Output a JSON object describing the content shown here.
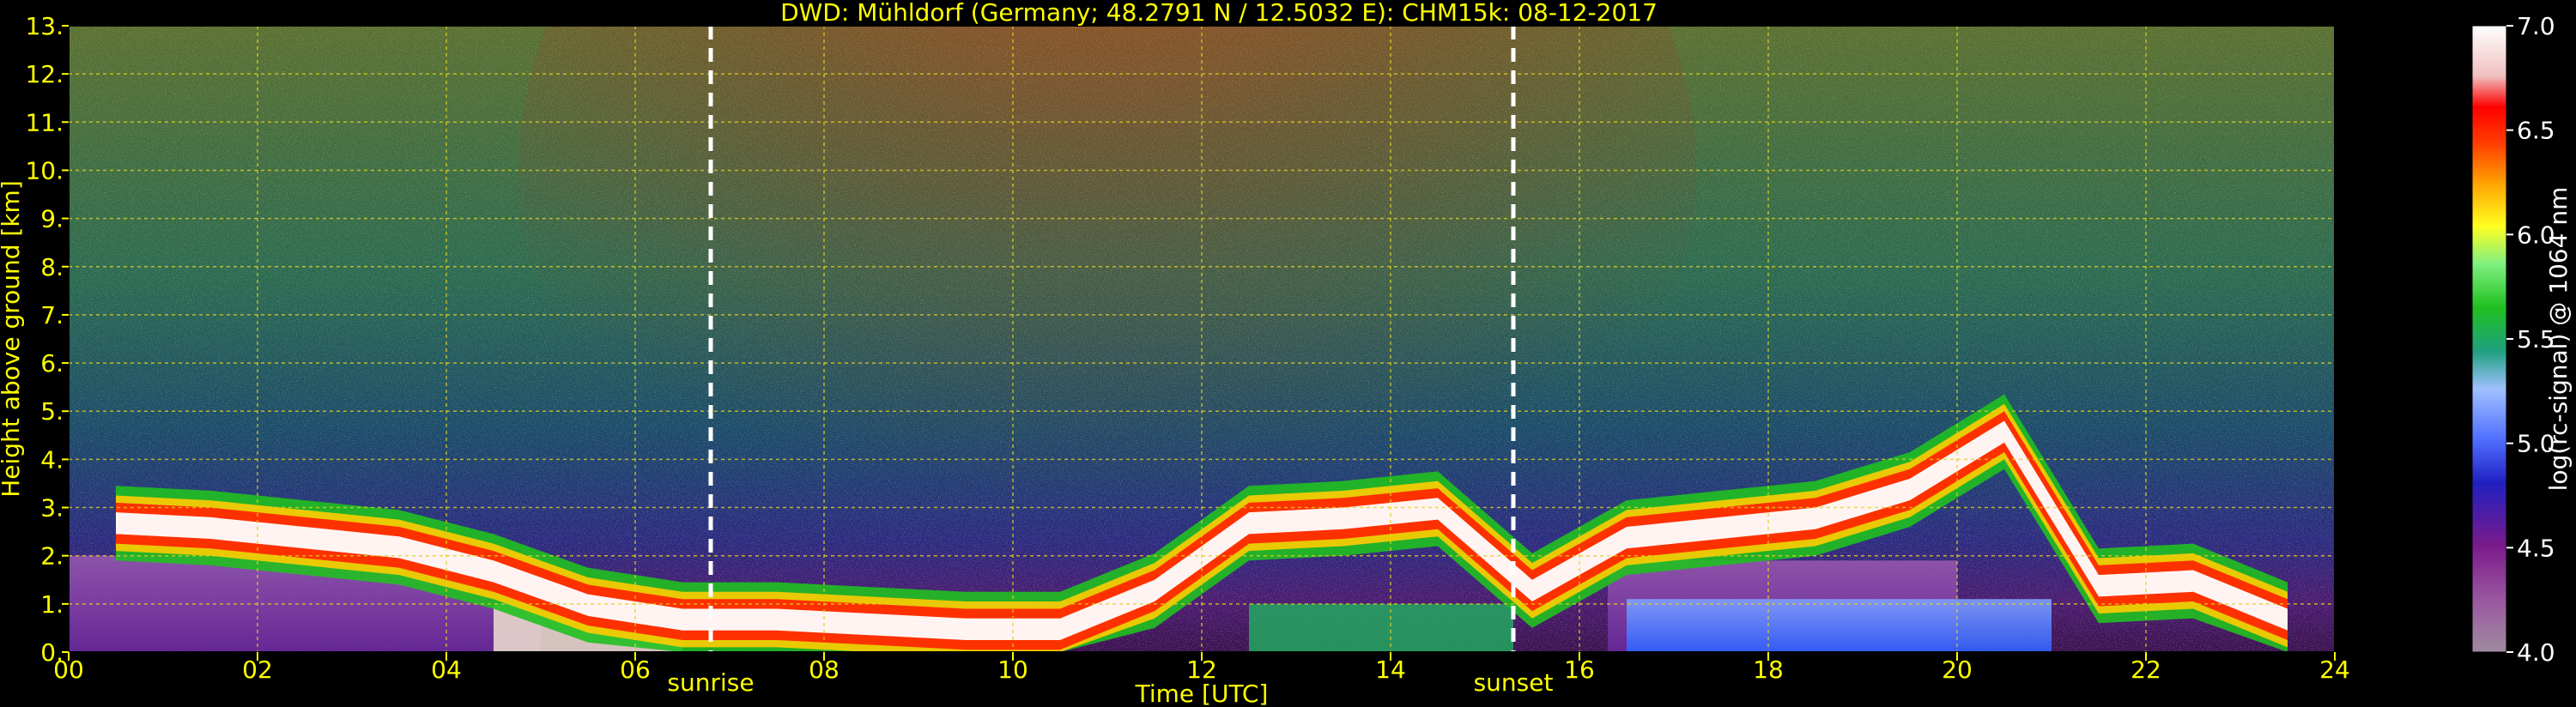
{
  "chart_data": {
    "type": "heatmap",
    "title": "DWD: Mühldorf (Germany; 48.2791 N / 12.5032 E):    CHM15k: 08-12-2017",
    "xlabel": "Time [UTC]",
    "ylabel": "Height above ground [km]",
    "xlim": [
      0,
      24
    ],
    "ylim": [
      0,
      13
    ],
    "x_ticks": [
      "00",
      "02",
      "04",
      "06",
      "08",
      "10",
      "12",
      "14",
      "16",
      "18",
      "20",
      "22",
      "24"
    ],
    "y_ticks": [
      "0.",
      "1.",
      "2.",
      "3.",
      "4.",
      "5.",
      "6.",
      "7.",
      "8.",
      "9.",
      "10.",
      "11.",
      "12.",
      "13."
    ],
    "grid": true,
    "markers": [
      {
        "label": "sunrise",
        "x": 6.8
      },
      {
        "label": "sunset",
        "x": 15.3
      }
    ],
    "colorbar": {
      "label": "log(rc-signal) @ 1064 nm",
      "range": [
        4.0,
        7.0
      ],
      "ticks": [
        "4.0",
        "4.5",
        "5.0",
        "5.5",
        "6.0",
        "6.5",
        "7.0"
      ]
    },
    "cloud_layer_top": [
      {
        "x": 0.5,
        "y": 2.9
      },
      {
        "x": 1.5,
        "y": 2.8
      },
      {
        "x": 2.5,
        "y": 2.6
      },
      {
        "x": 3.5,
        "y": 2.4
      },
      {
        "x": 4.5,
        "y": 1.9
      },
      {
        "x": 5.5,
        "y": 1.2
      },
      {
        "x": 6.5,
        "y": 0.9
      },
      {
        "x": 7.5,
        "y": 0.9
      },
      {
        "x": 8.5,
        "y": 0.8
      },
      {
        "x": 9.5,
        "y": 0.7
      },
      {
        "x": 10.5,
        "y": 0.7
      },
      {
        "x": 11.5,
        "y": 1.5
      },
      {
        "x": 12.5,
        "y": 2.9
      },
      {
        "x": 13.5,
        "y": 3.0
      },
      {
        "x": 14.5,
        "y": 3.2
      },
      {
        "x": 15.5,
        "y": 1.5
      },
      {
        "x": 16.5,
        "y": 2.6
      },
      {
        "x": 17.5,
        "y": 2.8
      },
      {
        "x": 18.5,
        "y": 3.0
      },
      {
        "x": 19.5,
        "y": 3.6
      },
      {
        "x": 20.5,
        "y": 4.8
      },
      {
        "x": 21.5,
        "y": 1.6
      },
      {
        "x": 22.5,
        "y": 1.7
      },
      {
        "x": 23.5,
        "y": 0.9
      }
    ],
    "colors": {
      "axis_text": "#ffff00",
      "grid": "#e0d020",
      "background": "#000000",
      "marker_line": "#ffffff"
    }
  }
}
